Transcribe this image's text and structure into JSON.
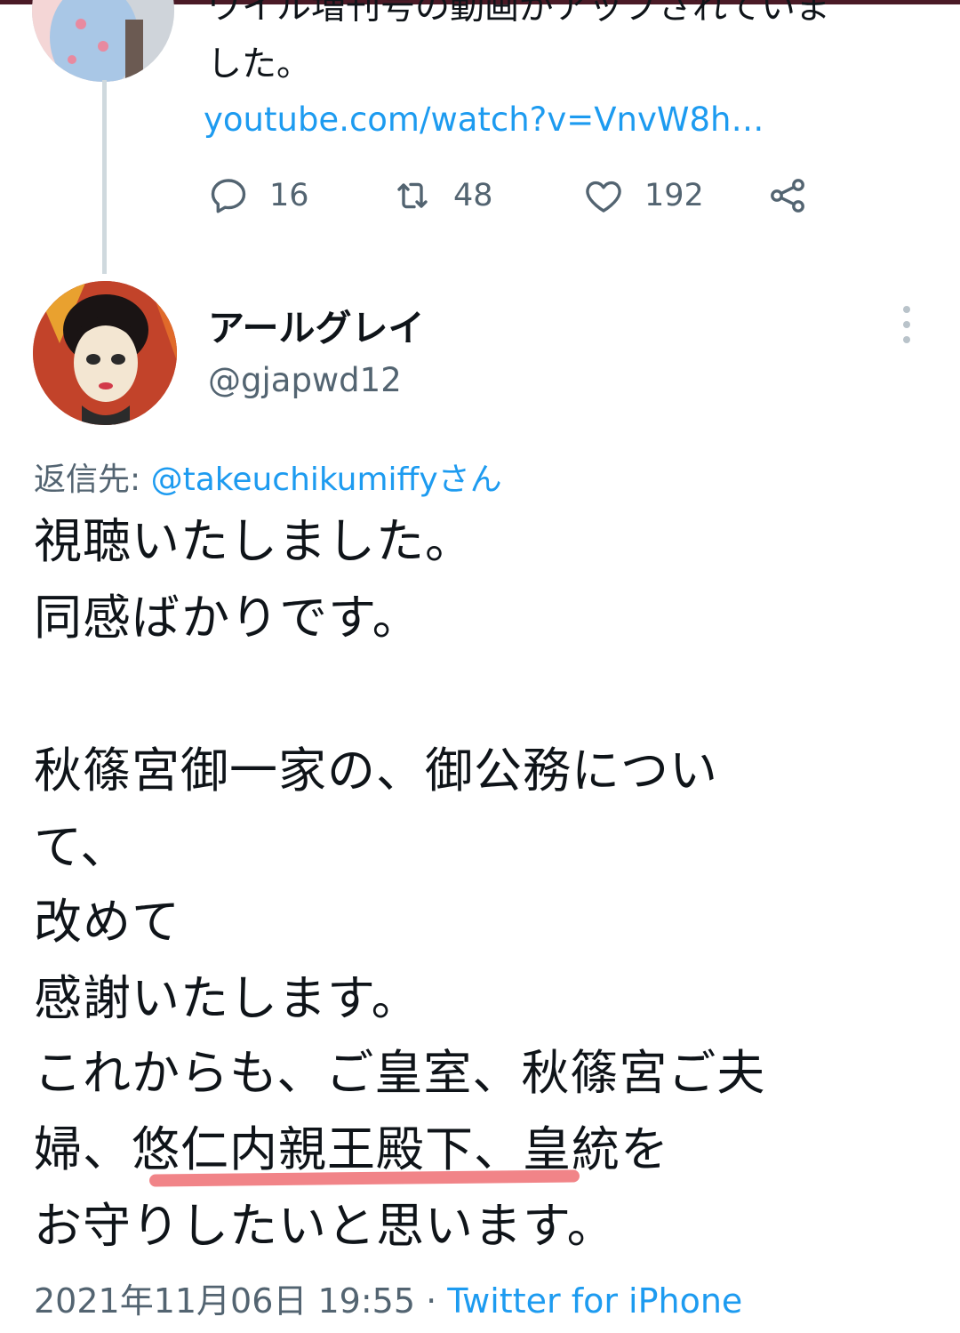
{
  "colors": {
    "accent": "#1d9bf0",
    "secondary_text": "#536471",
    "highlight": "#f0777b"
  },
  "previous_tweet": {
    "text_line1": "ワイル増刊号の動画がアップされていま",
    "text_line2": "した。",
    "link": "youtube.com/watch?v=VnvW8h…",
    "replies": "16",
    "retweets": "48",
    "likes": "192"
  },
  "tweet": {
    "display_name": "アールグレイ",
    "handle": "@gjapwd12",
    "reply_prefix": "返信先: ",
    "reply_mention": "@takeuchikumiffyさん",
    "lines": [
      "視聴いたしました。",
      "同感ばかりです。",
      "秋篠宮御一家の、御公務につい",
      "て、",
      "改めて",
      "感謝いたします。",
      "これからも、ご皇室、秋篠宮ご夫",
      "婦、悠仁内親王殿下、皇統を",
      "お守りしたいと思います。"
    ],
    "timestamp": "2021年11月06日 19:55 · ",
    "source": "Twitter for iPhone"
  }
}
